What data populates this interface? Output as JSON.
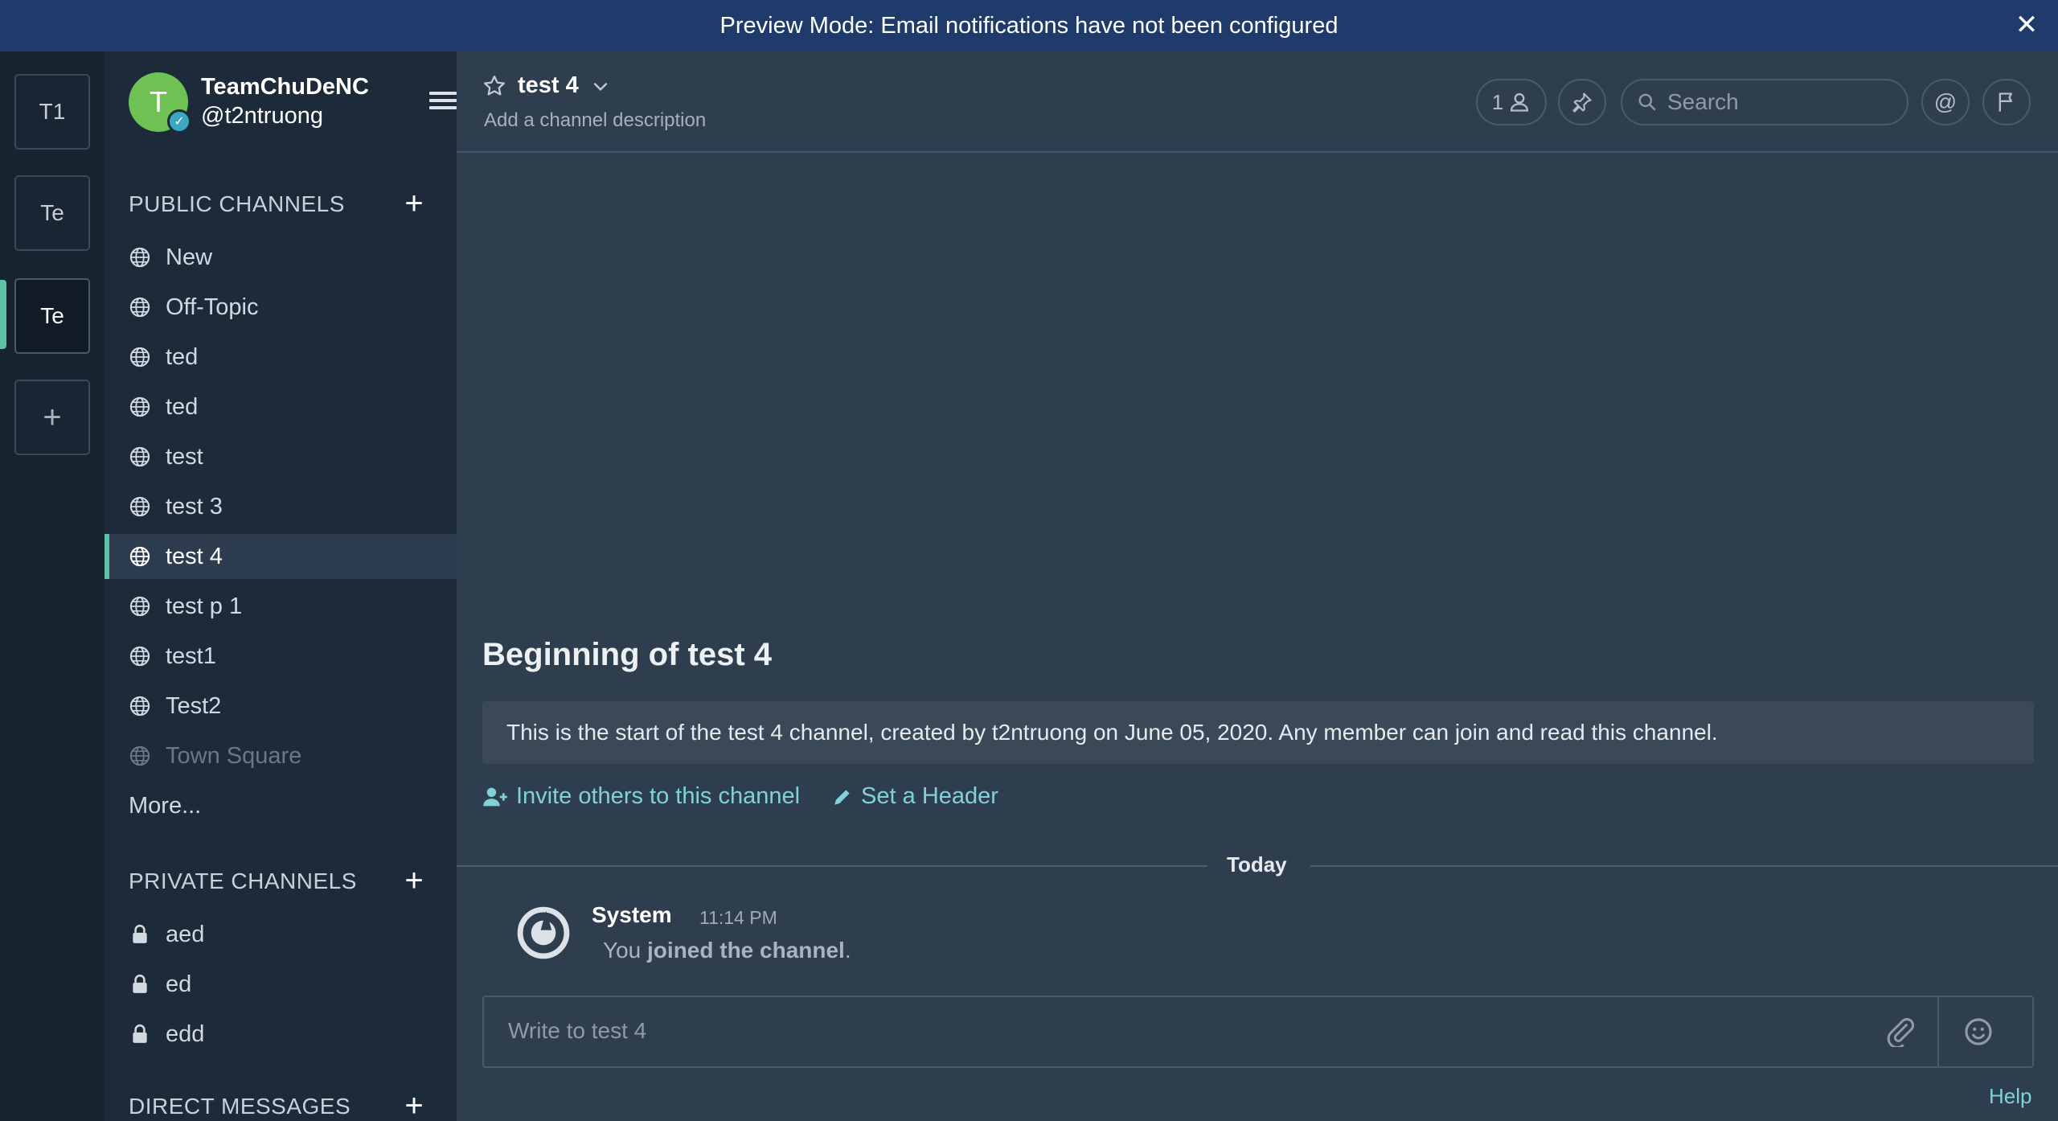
{
  "banner": {
    "text": "Preview Mode: Email notifications have not been configured",
    "close_label": "✕"
  },
  "teams": [
    {
      "label": "T1",
      "active": false
    },
    {
      "label": "Te",
      "active": false
    },
    {
      "label": "Te",
      "active": true
    }
  ],
  "team_add_label": "+",
  "team_header": {
    "avatar_letter": "T",
    "name": "TeamChuDeNC",
    "username": "@t2ntruong"
  },
  "public_channels": {
    "title": "PUBLIC CHANNELS",
    "add_label": "+",
    "items": [
      {
        "label": "New"
      },
      {
        "label": "Off-Topic"
      },
      {
        "label": "ted"
      },
      {
        "label": "ted"
      },
      {
        "label": "test"
      },
      {
        "label": "test 3"
      },
      {
        "label": "test 4"
      },
      {
        "label": "test p 1"
      },
      {
        "label": "test1"
      },
      {
        "label": "Test2"
      },
      {
        "label": "Town Square"
      }
    ],
    "more_label": "More..."
  },
  "private_channels": {
    "title": "PRIVATE CHANNELS",
    "add_label": "+",
    "items": [
      {
        "label": "aed"
      },
      {
        "label": "ed"
      },
      {
        "label": "edd"
      }
    ]
  },
  "direct_messages": {
    "title": "DIRECT MESSAGES",
    "add_label": "+"
  },
  "channel_header": {
    "name": "test 4",
    "description": "Add a channel description",
    "member_count": "1",
    "search_placeholder": "Search",
    "at_label": "@"
  },
  "intro": {
    "title": "Beginning of test 4",
    "text": "This is the start of the test 4 channel, created by t2ntruong on June 05, 2020. Any member can join and read this channel.",
    "invite_label": "Invite others to this channel",
    "header_label": "Set a Header"
  },
  "date_separator": "Today",
  "post": {
    "author": "System",
    "time": "11:14 PM",
    "msg_prefix": "You",
    "msg_bold": "joined the channel",
    "msg_suffix": "."
  },
  "composer": {
    "placeholder": "Write to test 4"
  },
  "help_label": "Help",
  "colors": {
    "accent": "#5fbfa7",
    "link": "#7fd3d8",
    "banner": "#1f3b6b",
    "sidebar": "#1d2a39",
    "main": "#2f3e4e"
  }
}
